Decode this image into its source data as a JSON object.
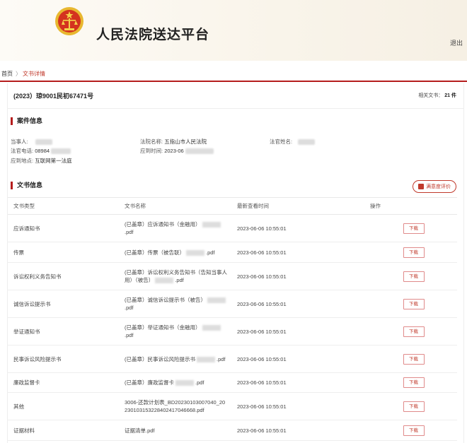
{
  "site": {
    "title": "人民法院送达平台",
    "logout": "退出"
  },
  "breadcrumb": {
    "home": "首页",
    "sep": "〉",
    "current": "文书详情"
  },
  "case": {
    "number": "(2023）琼9001民初67471号",
    "related_label": "相关文书：",
    "related_count": "21 件"
  },
  "case_info": {
    "title": "案件信息",
    "party_label": "当事人:",
    "court_label": "法院名称:",
    "court_value": "五指山市人民法院",
    "judge_label": "法官姓名:",
    "phone_label": "法官电话:",
    "phone_value": "08984",
    "time_label": "应到时间:",
    "time_value": "2023-06",
    "place_label": "应到地点:",
    "place_value": "互联网第一法庭"
  },
  "docs": {
    "title": "文书信息",
    "rating_label": "满意度评价",
    "headers": [
      "文书类型",
      "文书名称",
      "最新查看时间",
      "操作"
    ],
    "download_label": "下载",
    "rows": [
      {
        "type": "应诉通知书",
        "name_a": "(已盖章）应诉通知书（金融用）",
        "name_b": ".pdf",
        "time": "2023-06-06 10:55:01"
      },
      {
        "type": "传票",
        "name_a": "(已盖章）传票（被告联）",
        "name_b": ".pdf",
        "time": "2023-06-06 10:55:01"
      },
      {
        "type": "诉讼权利义务告知书",
        "name_a": "(已盖章）诉讼权利义务告知书（告知当事人用）（被告）",
        "name_b": ".pdf",
        "time": "2023-06-06 10:55:01"
      },
      {
        "type": "诚信诉讼提示书",
        "name_a": "(已盖章）诚信诉讼提示书（被告）",
        "name_b": ".pdf",
        "time": "2023-06-06 10:55:01"
      },
      {
        "type": "举证通知书",
        "name_a": "(已盖章）举证通知书（金融用）",
        "name_b": ".pdf",
        "time": "2023-06-06 10:55:01"
      },
      {
        "type": "民事诉讼风险提示书",
        "name_a": "(已盖章）民事诉讼风险提示书",
        "name_b": ".pdf",
        "time": "2023-06-06 10:55:01"
      },
      {
        "type": "廉政监督卡",
        "name_a": "(已盖章）廉政监督卡",
        "name_b": ".pdf",
        "time": "2023-06-06 10:55:01"
      },
      {
        "type": "其他",
        "name_a": "3006-还款计划表_BD20230103007040_20230103153228402417046668.pdf",
        "name_b": "",
        "time": "2023-06-06 10:55:01"
      },
      {
        "type": "证据材料",
        "name_a": "证据清单.pdf",
        "name_b": "",
        "time": "2023-06-06 10:55:01"
      }
    ]
  },
  "colors": {
    "accent": "#b51d1d"
  },
  "icons": {
    "emblem": "court-emblem-icon",
    "rating": "rating-icon"
  }
}
